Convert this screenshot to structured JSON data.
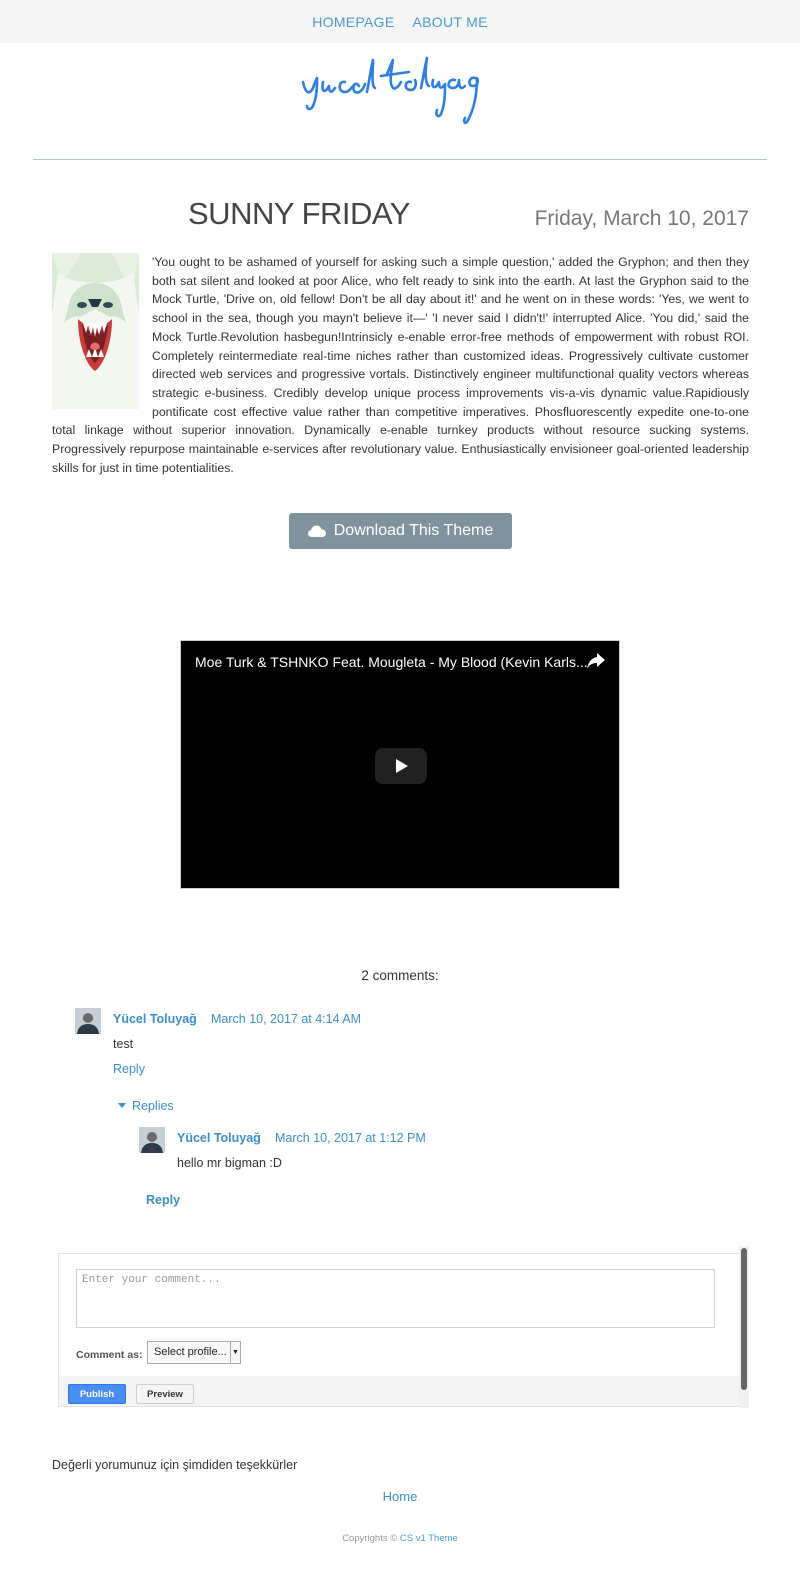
{
  "nav": {
    "items": [
      {
        "label": "HOMEPAGE"
      },
      {
        "label": "ABOUT ME"
      }
    ]
  },
  "logo": {
    "text": "yucel toluyag",
    "color": "#2f7fe0"
  },
  "post": {
    "title": "SUNNY FRIDAY",
    "date": "Friday, March 10, 2017",
    "body": "'You ought to be ashamed of yourself for asking such a simple question,' added the Gryphon; and then they both sat silent and looked at poor Alice, who felt ready to sink into the earth. At last the Gryphon said to the Mock Turtle, 'Drive on, old fellow! Don't be all day about it!' and he went on in these words: 'Yes, we went to school in the sea, though you mayn't believe it—' 'I never said I didn't!' interrupted Alice. 'You did,' said the Mock Turtle.Revolution hasbegun!Intrinsicly e-enable error-free methods of empowerment with robust ROI. Completely reintermediate real-time niches rather than customized ideas. Progressively cultivate customer directed web services and progressive vortals. Distinctively engineer multifunctional quality vectors whereas strategic e-business. Credibly develop unique process improvements vis-a-vis dynamic value.Rapidiously pontificate cost effective value rather than competitive imperatives. Phosfluorescently expedite one-to-one total linkage without superior innovation. Dynamically e-enable turnkey products without resource sucking systems. Progressively repurpose maintainable e-services after revolutionary value. Enthusiastically envisioneer goal-oriented leadership skills for just in time potentialities.",
    "image_icon": "polar-bear-illustration"
  },
  "download_button": {
    "label": "Download This Theme",
    "icon": "cloud-icon",
    "color": "#7f939f"
  },
  "video": {
    "title": "Moe Turk & TSHNKO Feat. Mougleta - My Blood (Kevin Karls...",
    "share_icon": "share-icon",
    "play_icon": "play-icon"
  },
  "comments": {
    "count_label": "2 comments:",
    "items": [
      {
        "author": "Yücel Toluyağ",
        "date": "March 10, 2017 at 4:14 AM",
        "text": "test",
        "reply_label": "Reply"
      },
      {
        "author": "Yücel Toluyağ",
        "date": "March 10, 2017 at 1:12 PM",
        "text": "hello mr bigman :D",
        "reply_label": "Reply"
      }
    ],
    "replies_label": "Replies"
  },
  "comment_form": {
    "placeholder": "Enter your comment...",
    "comment_as_label": "Comment as:",
    "profile_select": "Select profile...",
    "publish_label": "Publish",
    "preview_label": "Preview",
    "publish_color": "#4a8ef1"
  },
  "footer": {
    "thanks": "Değerli yorumunuz için şimdiden teşekkürler",
    "home_link": "Home",
    "copyright_prefix": "Copyrights ©",
    "copyright_link": "CS v1 Theme"
  }
}
